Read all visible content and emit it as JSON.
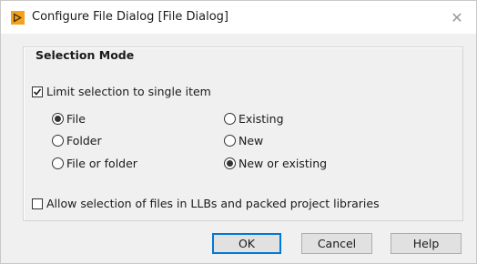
{
  "window": {
    "title": "Configure File Dialog [File Dialog]",
    "close_symbol": "✕"
  },
  "selection_mode": {
    "group_title": "Selection Mode",
    "limit_single": {
      "label": "Limit selection to single item",
      "checked": true
    },
    "type_options": [
      {
        "label": "File",
        "selected": true
      },
      {
        "label": "Folder",
        "selected": false
      },
      {
        "label": "File or folder",
        "selected": false
      }
    ],
    "existence_options": [
      {
        "label": "Existing",
        "selected": false
      },
      {
        "label": "New",
        "selected": false
      },
      {
        "label": "New or existing",
        "selected": true
      }
    ],
    "allow_llb": {
      "label": "Allow selection of files in LLBs and packed project libraries",
      "checked": false
    }
  },
  "buttons": {
    "ok": "OK",
    "cancel": "Cancel",
    "help": "Help"
  },
  "colors": {
    "app_icon": "#f4a11c",
    "default_button_border": "#0078d7"
  }
}
